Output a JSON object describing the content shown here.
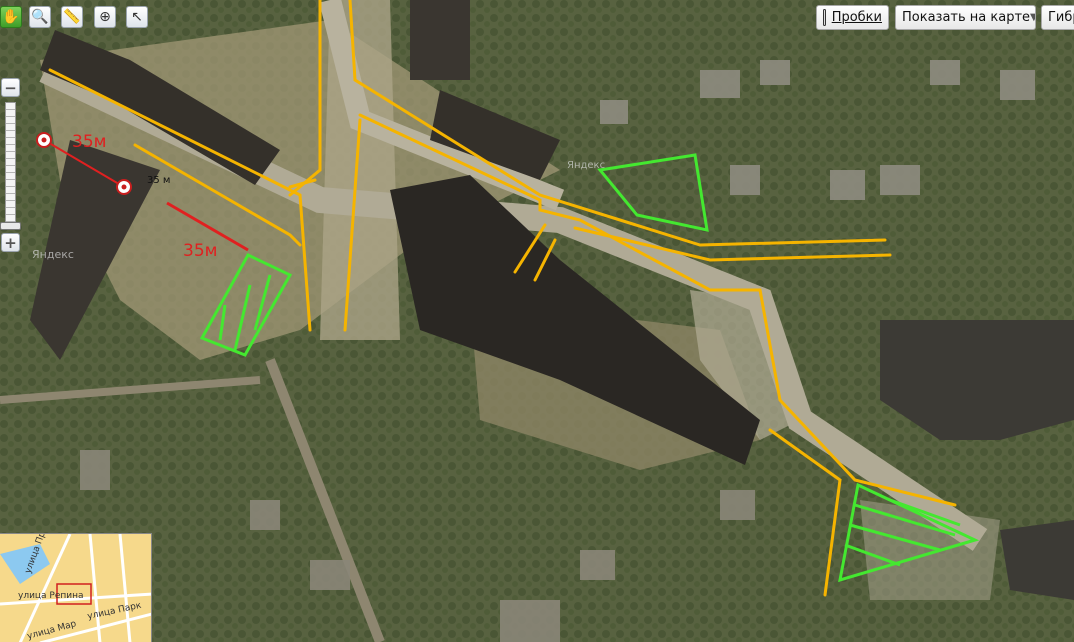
{
  "map": {
    "labels": {
      "distance_top": "35м",
      "distance_small": "35 м",
      "distance_bottom": "35м",
      "watermark_left": "Яндекс",
      "watermark_center": "Яндекс"
    },
    "colors": {
      "path_lines": "#f5b400",
      "measure_line": "#e02020",
      "zone_outline": "#44e830"
    }
  },
  "toolbar": {
    "tools": [
      {
        "name": "hand-tool",
        "icon": "hand-icon"
      },
      {
        "name": "magnifier-tool",
        "icon": "magnifier-icon"
      },
      {
        "name": "ruler-tool",
        "icon": "ruler-icon"
      },
      {
        "name": "add-point-tool",
        "icon": "add-point-icon"
      },
      {
        "name": "cursor-tool",
        "icon": "cursor-icon"
      }
    ]
  },
  "top_controls": {
    "traffic_label": "Пробки",
    "show_on_map_label": "Показать на карте",
    "hybrid_label": "Гибр"
  },
  "zoom": {
    "plus": "+",
    "minus": "−"
  },
  "minimap": {
    "streets": [
      "улица Профсоюзная",
      "улица Репина",
      "улица Парк",
      "улица Мар"
    ]
  }
}
